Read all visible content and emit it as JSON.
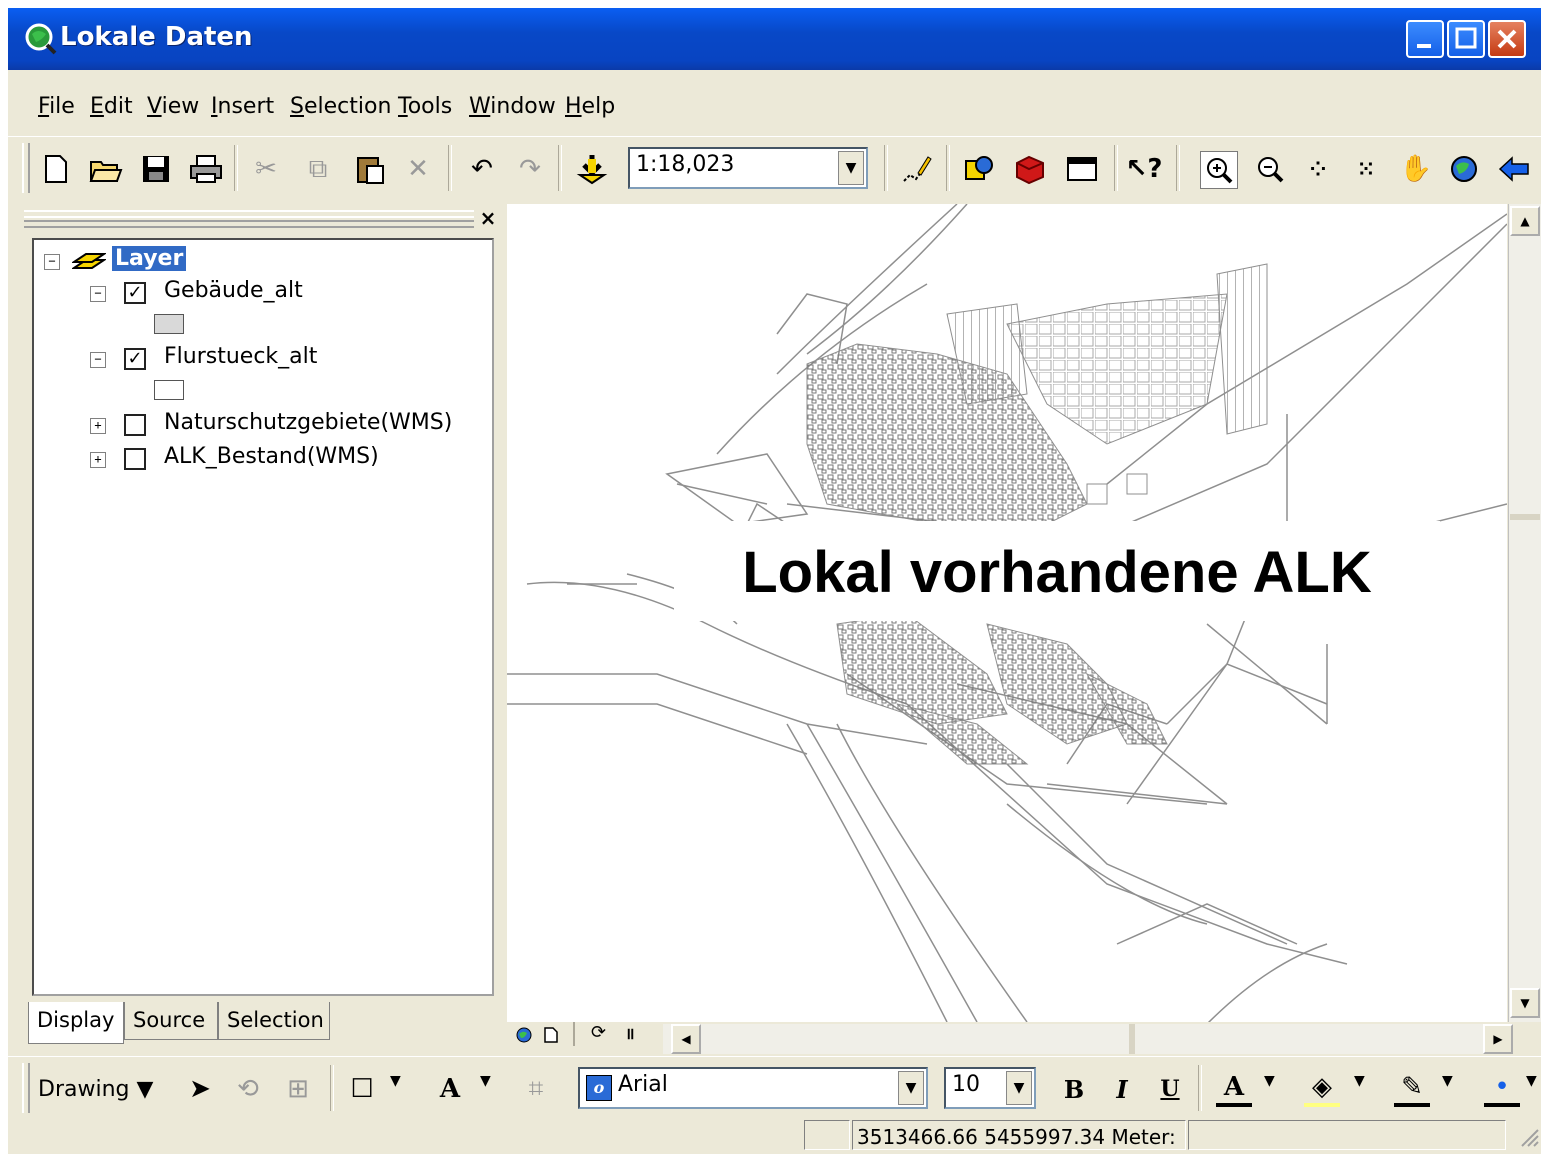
{
  "window": {
    "title": "Lokale Daten"
  },
  "menu": [
    {
      "label": "File",
      "mnemonic": "F",
      "rest": "ile"
    },
    {
      "label": "Edit",
      "mnemonic": "E",
      "rest": "dit"
    },
    {
      "label": "View",
      "mnemonic": "V",
      "rest": "iew"
    },
    {
      "label": "Insert",
      "mnemonic": "I",
      "rest": "nsert"
    },
    {
      "label": "Selection",
      "mnemonic": "S",
      "rest": "election"
    },
    {
      "label": "Tools",
      "mnemonic": "T",
      "rest": "ools"
    },
    {
      "label": "Window",
      "mnemonic": "W",
      "rest": "indow"
    },
    {
      "label": "Help",
      "mnemonic": "H",
      "rest": "elp"
    }
  ],
  "standard_toolbar": {
    "scale": "1:18,023"
  },
  "toc": {
    "root_label": "Layer",
    "layers": [
      {
        "name": "Gebäude_alt",
        "checked": true,
        "expanded": true,
        "symbol": "gray"
      },
      {
        "name": "Flurstueck_alt",
        "checked": true,
        "expanded": true,
        "symbol": "white"
      },
      {
        "name": "Naturschutzgebiete(WMS)",
        "checked": false,
        "expanded": false
      },
      {
        "name": "ALK_Bestand(WMS)",
        "checked": false,
        "expanded": false
      }
    ],
    "tabs": [
      "Display",
      "Source",
      "Selection"
    ],
    "active_tab": "Display"
  },
  "map": {
    "overlay_text": "Lokal vorhandene ALK"
  },
  "drawing_toolbar": {
    "drawing_label": "Drawing",
    "font": "Arial",
    "font_size": "10"
  },
  "status": {
    "coordinates": "3513466.66  5455997.34 Meter:"
  },
  "colors": {
    "title_bar": "#0a5ef2",
    "selection": "#316ac5",
    "face": "#ece9d8"
  }
}
